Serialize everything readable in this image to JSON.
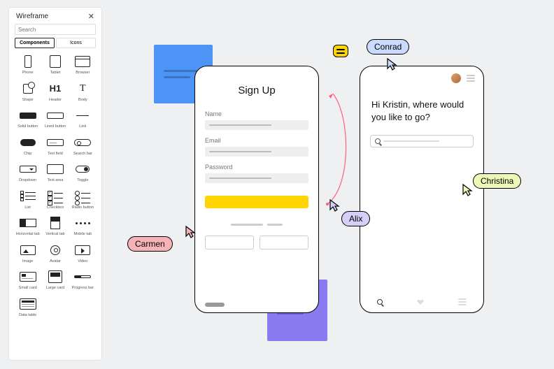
{
  "sidebar": {
    "title": "Wireframe",
    "search_placeholder": "Search",
    "tabs": {
      "components": "Components",
      "icons": "Icons"
    },
    "items": [
      {
        "label": "Phone"
      },
      {
        "label": "Tablet"
      },
      {
        "label": "Browser"
      },
      {
        "label": "Shape"
      },
      {
        "label": "Header"
      },
      {
        "label": "Body"
      },
      {
        "label": "Solid button"
      },
      {
        "label": "Lined button"
      },
      {
        "label": "Link"
      },
      {
        "label": "Chip"
      },
      {
        "label": "Text field"
      },
      {
        "label": "Search bar"
      },
      {
        "label": "Dropdown"
      },
      {
        "label": "Text area"
      },
      {
        "label": "Toggle"
      },
      {
        "label": "List"
      },
      {
        "label": "Checkbox"
      },
      {
        "label": "Radio button"
      },
      {
        "label": "Horizontal tab"
      },
      {
        "label": "Vertical tab"
      },
      {
        "label": "Mobile tab"
      },
      {
        "label": "Image"
      },
      {
        "label": "Avatar"
      },
      {
        "label": "Video"
      },
      {
        "label": "Small card"
      },
      {
        "label": "Large card"
      },
      {
        "label": "Progress bar"
      },
      {
        "label": "Data table"
      }
    ],
    "header_glyph": "H1",
    "body_glyph": "T"
  },
  "mock_a": {
    "title": "Sign Up",
    "name_label": "Name",
    "email_label": "Email",
    "password_label": "Password"
  },
  "mock_b": {
    "greeting": "Hi Kristin, where would you like to go?"
  },
  "collaborators": {
    "carmen": "Carmen",
    "alix": "Alix",
    "conrad": "Conrad",
    "christina": "Christina"
  }
}
